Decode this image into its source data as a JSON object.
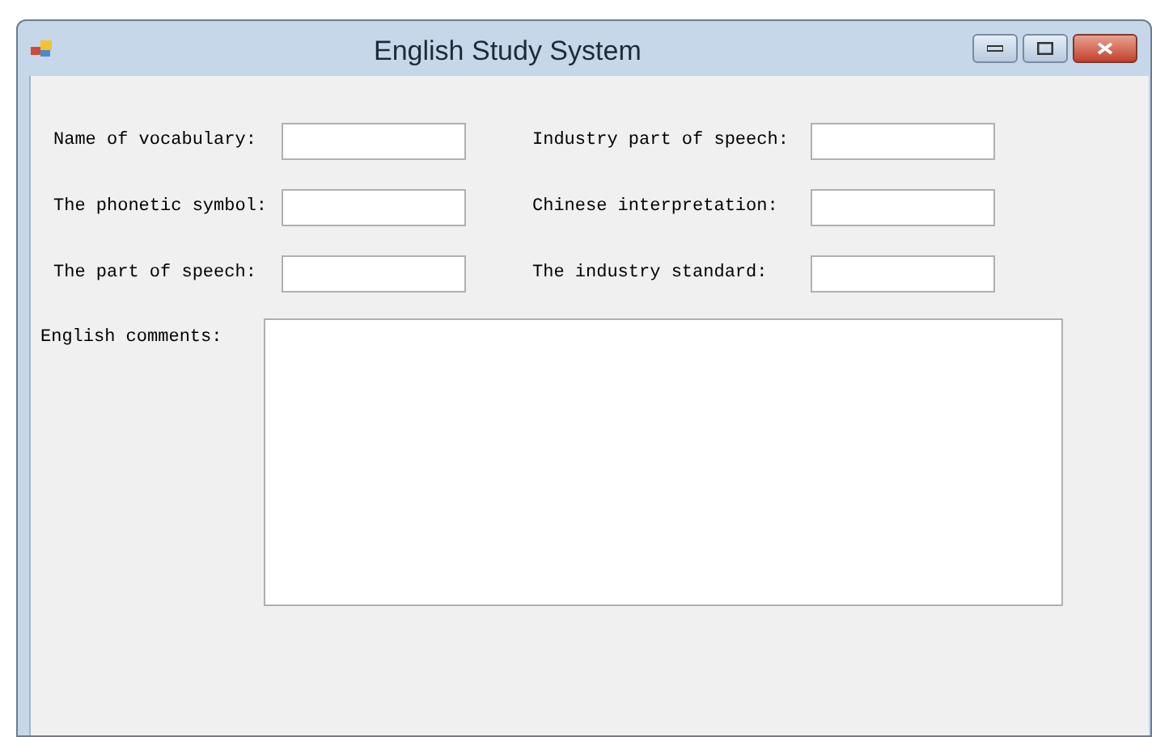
{
  "window": {
    "title": "English Study System"
  },
  "fields": [
    {
      "label": "Name of vocabulary:"
    },
    {
      "label": "Industry part of speech:"
    },
    {
      "label": "The phonetic symbol:"
    },
    {
      "label": "Chinese interpretation:"
    },
    {
      "label": "The part of speech:"
    },
    {
      "label": "The industry standard:"
    }
  ],
  "comments": {
    "label": "English comments:"
  }
}
